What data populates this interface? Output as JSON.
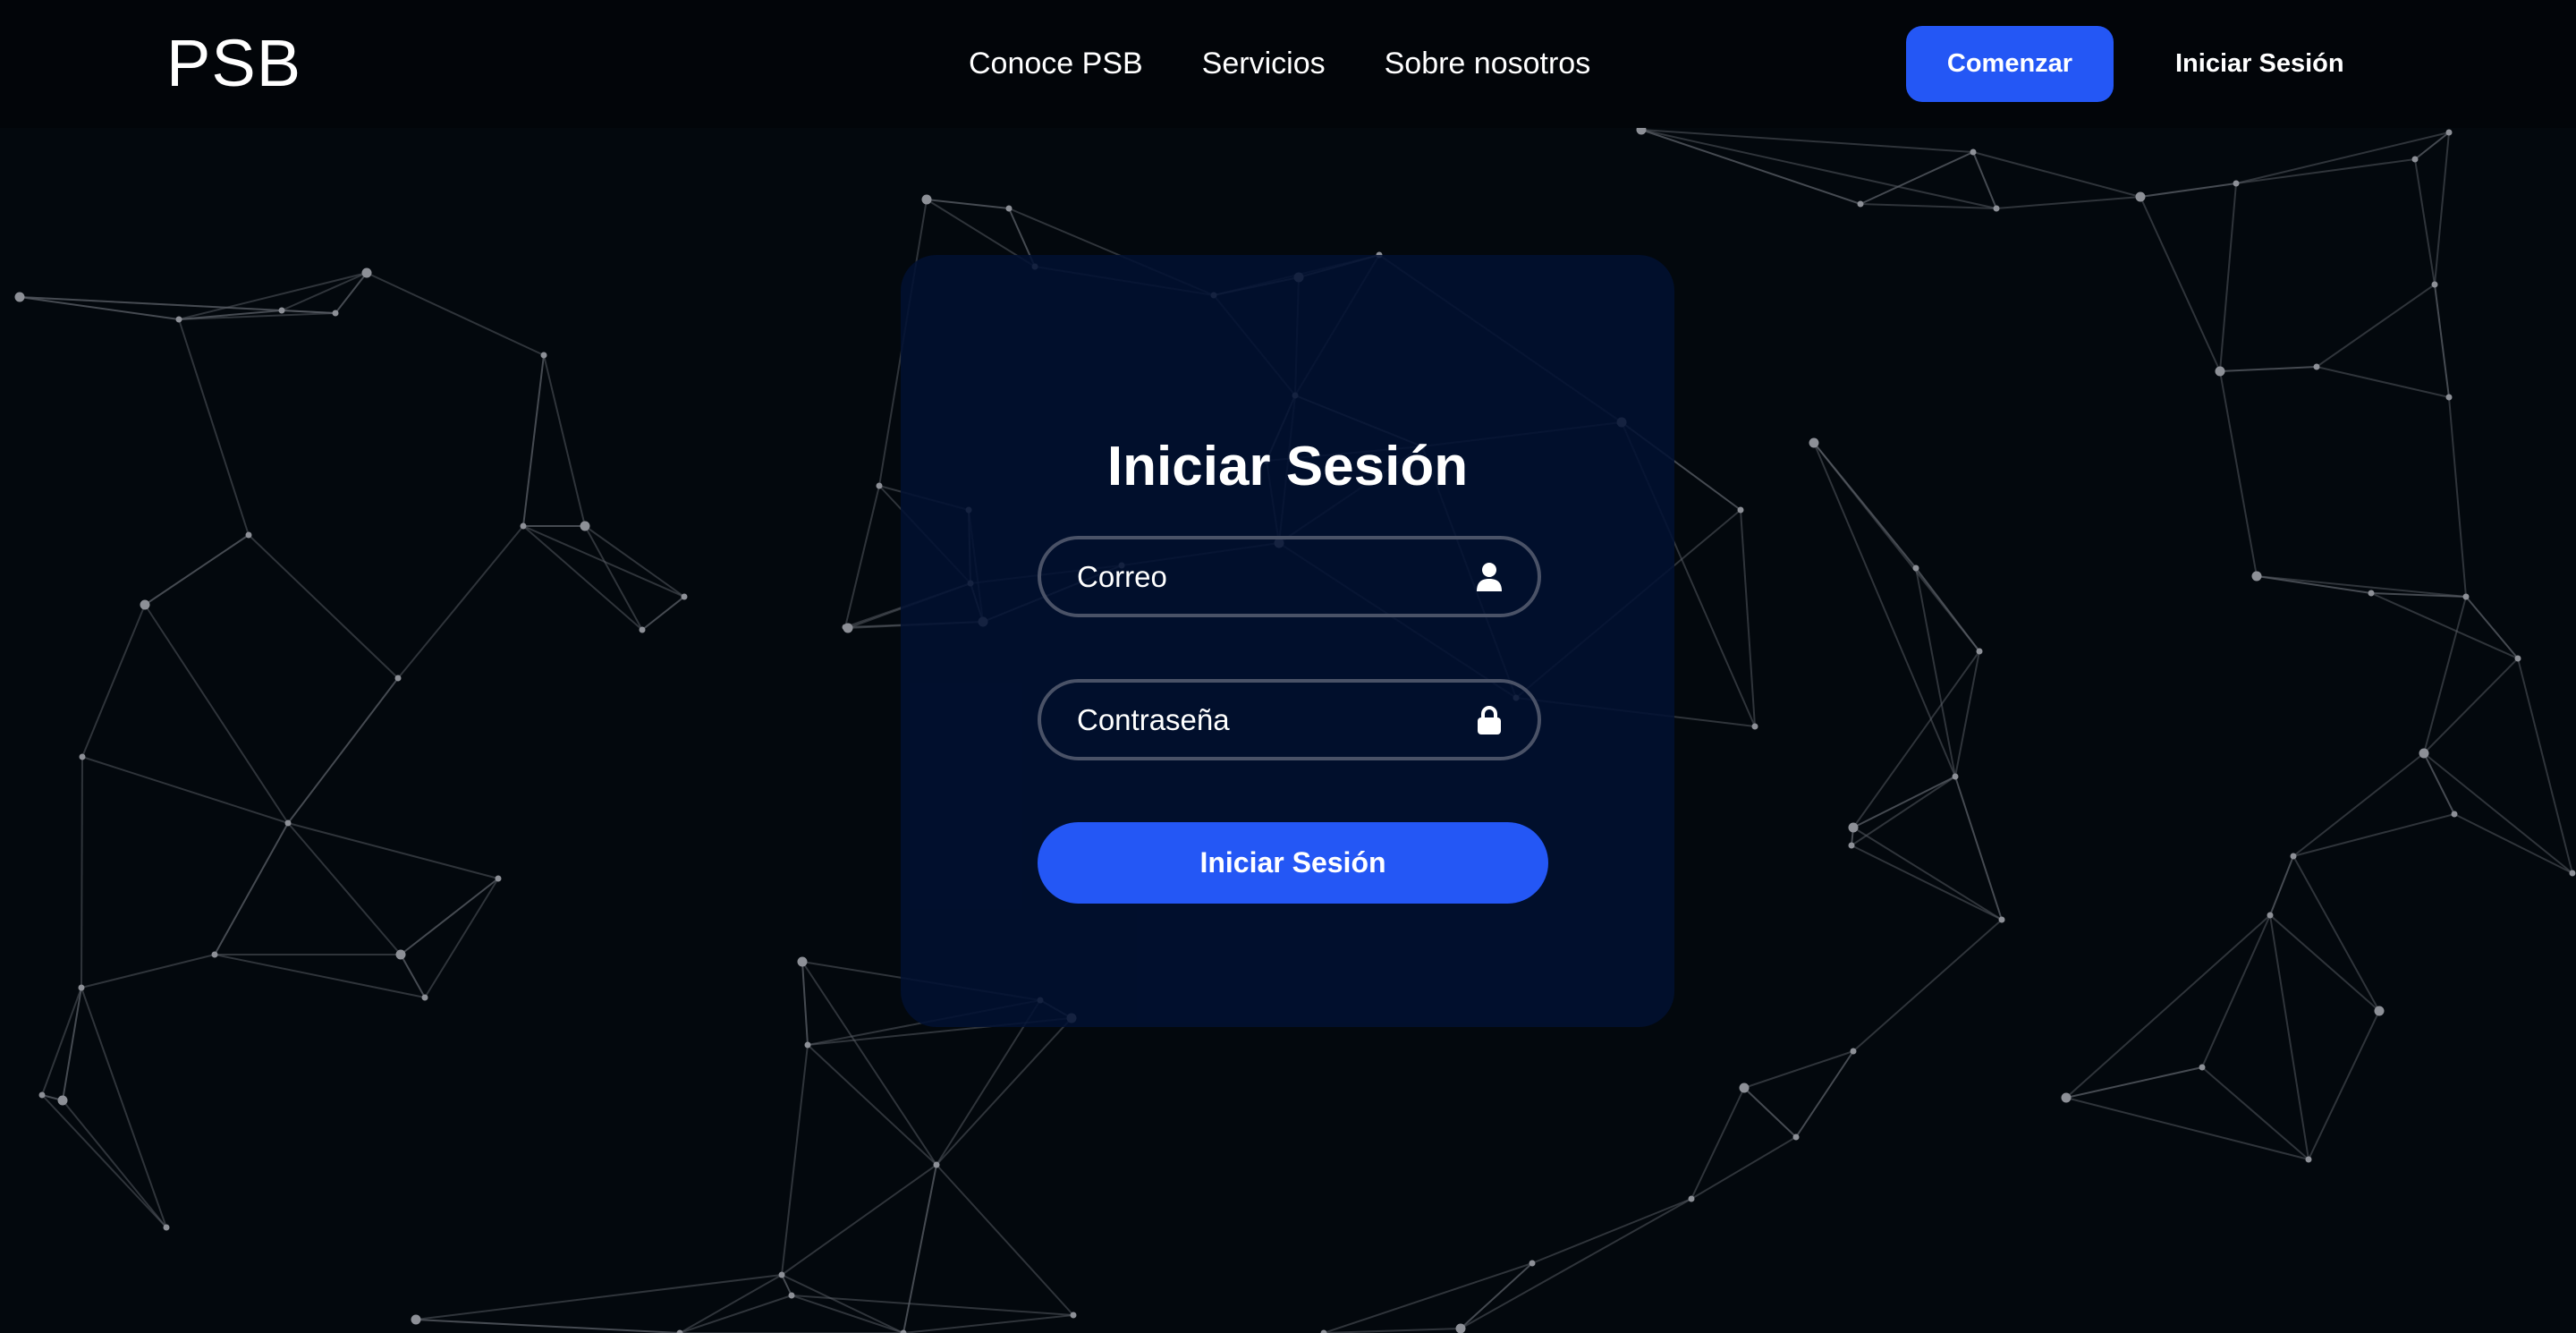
{
  "header": {
    "brand": "PSB",
    "nav": [
      {
        "label": "Conoce PSB"
      },
      {
        "label": "Servicios"
      },
      {
        "label": "Sobre nosotros"
      }
    ],
    "cta_label": "Comenzar",
    "login_label": "Iniciar Sesión"
  },
  "login_card": {
    "title": "Iniciar Sesión",
    "email_placeholder": "Correo",
    "password_placeholder": "Contraseña",
    "submit_label": "Iniciar Sesión"
  },
  "icons": {
    "email_field": "user-icon",
    "password_field": "lock-icon"
  },
  "colors": {
    "background": "#03080d",
    "header": "#020509",
    "accent": "#2457f5",
    "card": "#011032",
    "field_border": "#4a5267",
    "network_line": "#5c6068",
    "network_node": "#8d9097"
  }
}
